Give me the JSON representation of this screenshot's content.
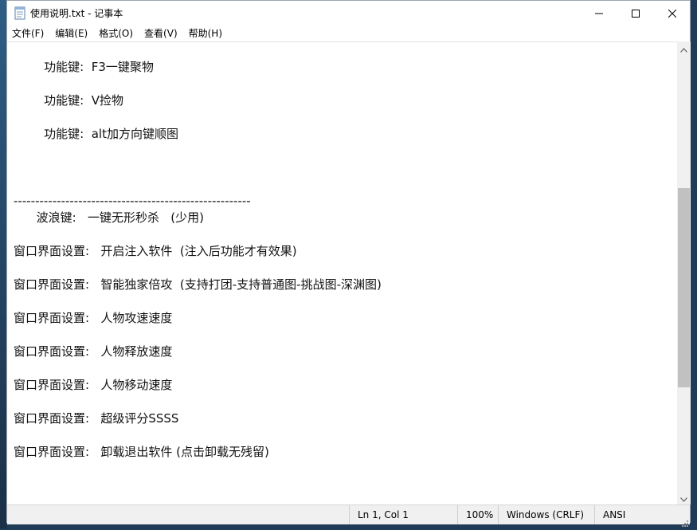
{
  "window": {
    "title": "使用说明.txt - 记事本"
  },
  "menu": {
    "items": [
      {
        "label": "文件(F)"
      },
      {
        "label": "编辑(E)"
      },
      {
        "label": "格式(O)"
      },
      {
        "label": "查看(V)"
      },
      {
        "label": "帮助(H)"
      }
    ]
  },
  "editor": {
    "lines": [
      "        功能键:  F3一键聚物",
      "        功能键:  V捡物",
      "        功能键:  alt加方向键顺图",
      "",
      "-------------------------------------------------------",
      "      波浪键:   一键无形秒杀   (少用)",
      "窗口界面设置:   开启注入软件  (注入后功能才有效果)",
      "窗口界面设置:   智能独家倍攻  (支持打团-支持普通图-挑战图-深渊图)",
      "窗口界面设置:   人物攻速速度",
      "窗口界面设置:   人物释放速度",
      "窗口界面设置:   人物移动速度",
      "窗口界面设置:   超级评分SSSS",
      "窗口界面设置:   卸载退出软件 (点击卸载无残留)"
    ]
  },
  "status": {
    "position": "Ln 1, Col 1",
    "zoom": "100%",
    "line_ending": "Windows (CRLF)",
    "encoding": "ANSI"
  },
  "icons": {
    "app": "notepad-icon",
    "minimize": "minimize-icon",
    "maximize": "maximize-icon",
    "close": "close-icon"
  }
}
